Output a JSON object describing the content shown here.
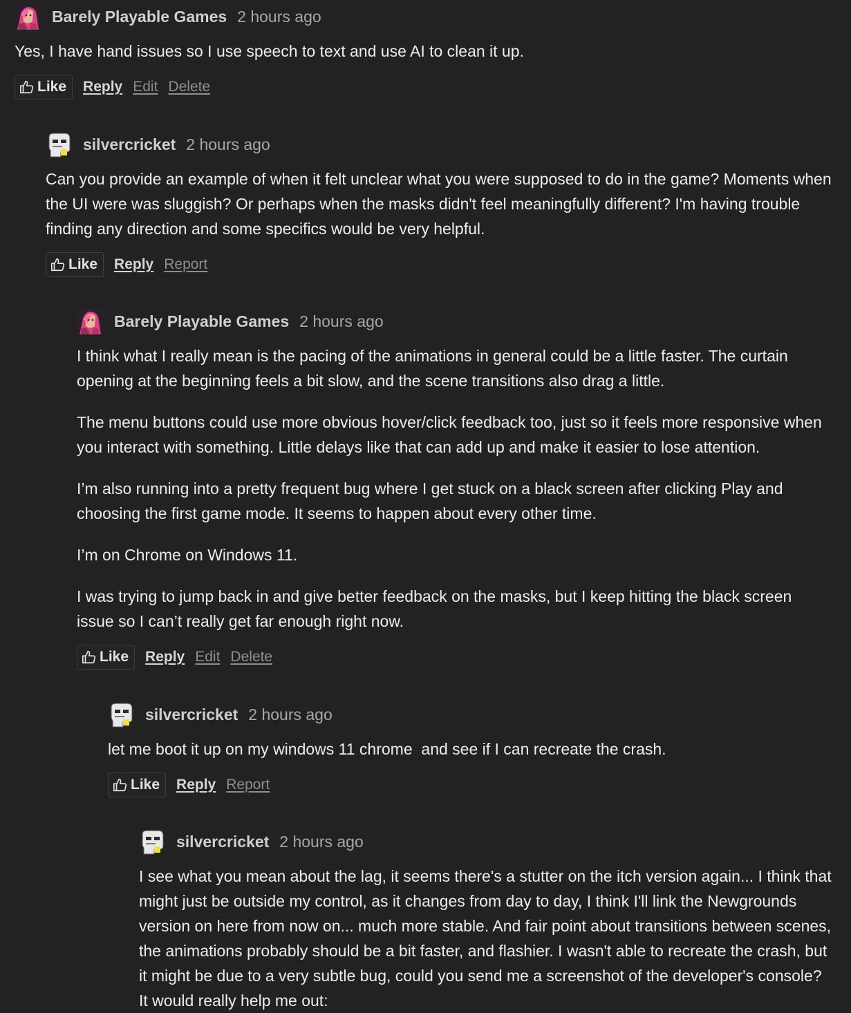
{
  "users": {
    "bpg": "Barely Playable Games",
    "sc": "silvercricket"
  },
  "comments": [
    {
      "author": "Barely Playable Games",
      "time": "2 hours ago",
      "avatar_icon": "user-avatar-icon",
      "paragraphs": [
        "Yes, I have hand issues so I use speech to text and use AI to clean it up."
      ],
      "actions": {
        "like": "Like",
        "reply": "Reply",
        "edit": "Edit",
        "delete": "Delete"
      }
    },
    {
      "author": "silvercricket",
      "time": "2 hours ago",
      "avatar_icon": "user-avatar-icon",
      "paragraphs": [
        "Can you provide an example of when it felt unclear what you were supposed to do in the game? Moments when the UI were was sluggish? Or perhaps when the masks didn't feel meaningfully different? I'm having trouble finding any direction and some specifics would be very helpful."
      ],
      "actions": {
        "like": "Like",
        "reply": "Reply",
        "report": "Report"
      }
    },
    {
      "author": "Barely Playable Games",
      "time": "2 hours ago",
      "avatar_icon": "user-avatar-icon",
      "paragraphs": [
        "I think what I really mean is the pacing of the animations in general could be a little faster. The curtain opening at the beginning feels a bit slow, and the scene transitions also drag a little.",
        "The menu buttons could use more obvious hover/click feedback too, just so it feels more responsive when you interact with something. Little delays like that can add up and make it easier to lose attention.",
        "I’m also running into a pretty frequent bug where I get stuck on a black screen after clicking Play and choosing the first game mode. It seems to happen about every other time.",
        "I’m on Chrome on Windows 11.",
        "I was trying to jump back in and give better feedback on the masks, but I keep hitting the black screen issue so I can’t really get far enough right now."
      ],
      "actions": {
        "like": "Like",
        "reply": "Reply",
        "edit": "Edit",
        "delete": "Delete"
      }
    },
    {
      "author": "silvercricket",
      "time": "2 hours ago",
      "avatar_icon": "user-avatar-icon",
      "paragraphs": [
        "let me boot it up on my windows 11 chrome  and see if I can recreate the crash."
      ],
      "actions": {
        "like": "Like",
        "reply": "Reply",
        "report": "Report"
      }
    },
    {
      "author": "silvercricket",
      "time": "2 hours ago",
      "avatar_icon": "user-avatar-icon",
      "paragraphs": [
        "I see what you mean about the lag, it seems there's a stutter on the itch version again... I think that might just be outside my control, as it changes from day to day, I think I'll link the Newgrounds version on here from now on... much more stable. And fair point about transitions between scenes, the animations probably should be a bit faster, and flashier. I wasn't able to recreate the crash, but it might be due to a very subtle bug, could you send me a screenshot of the developer's console? It would really help me out:"
      ]
    }
  ]
}
